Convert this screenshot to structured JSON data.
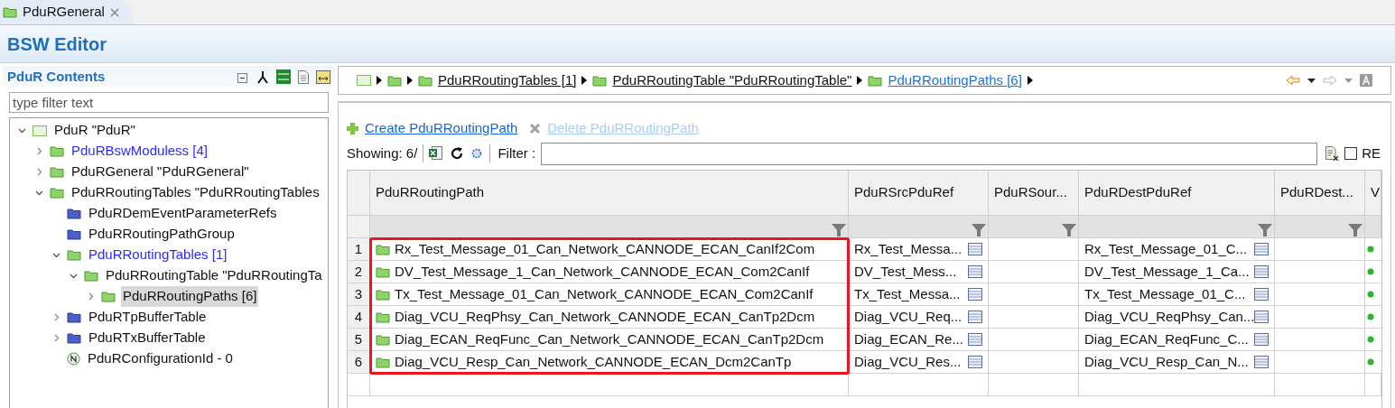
{
  "editor_tab": {
    "label": "PduRGeneral",
    "selected": true
  },
  "editor_title": "BSW Editor",
  "contents_panel": {
    "title": "PduR Contents",
    "filter": {
      "placeholder": "type filter text"
    },
    "tree": [
      {
        "label": "PduR \"PduR\"",
        "kind": "container",
        "expanded": true,
        "children": [
          {
            "label": "PduRBswModuless [4]",
            "kind": "folder",
            "linked": true,
            "expanded": false
          },
          {
            "label": "PduRGeneral \"PduRGeneral\"",
            "kind": "folder",
            "linked": false,
            "expanded": false
          },
          {
            "label": "PduRRoutingTables \"PduRRoutingTables",
            "kind": "folder",
            "linked": false,
            "expanded": true,
            "children": [
              {
                "label": "PduRDemEventParameterRefs",
                "kind": "blue-folder",
                "linked": false
              },
              {
                "label": "PduRRoutingPathGroup",
                "kind": "blue-folder",
                "linked": false
              },
              {
                "label": "PduRRoutingTables [1]",
                "kind": "folder",
                "linked": true,
                "expanded": true,
                "children": [
                  {
                    "label": "PduRRoutingTable \"PduRRoutingTa",
                    "kind": "folder",
                    "linked": false,
                    "expanded": true,
                    "children": [
                      {
                        "label": "PduRRoutingPaths [6]",
                        "kind": "folder",
                        "linked": false,
                        "expanded": false,
                        "selected": true
                      }
                    ]
                  }
                ]
              },
              {
                "label": "PduRTpBufferTable",
                "kind": "blue-folder",
                "linked": false,
                "expanded": false
              },
              {
                "label": "PduRTxBufferTable",
                "kind": "blue-folder",
                "linked": false,
                "expanded": false
              },
              {
                "label": "PduRConfigurationId - 0",
                "kind": "parameter",
                "linked": false
              }
            ]
          }
        ]
      }
    ]
  },
  "breadcrumb": [
    {
      "label": "PduRRoutingTables [1]",
      "current": false
    },
    {
      "label": "PduRRoutingTable \"PduRRoutingTable\"",
      "current": false
    },
    {
      "label": "PduRRoutingPaths [6]",
      "current": true
    }
  ],
  "actions": [
    {
      "label": "Create PduRRoutingPath",
      "disabled": false
    },
    {
      "label": "Delete PduRRoutingPath",
      "disabled": true
    }
  ],
  "showing": "Showing: 6/",
  "filter_label": "Filter :",
  "re_option": {
    "label": "RE",
    "checked": false
  },
  "table": {
    "columns": [
      "PduRRoutingPath",
      "PduRSrcPduRef",
      "PduRSour...",
      "PduRDestPduRef",
      "PduRDest...",
      "V"
    ],
    "rows": [
      {
        "number": "1",
        "path": "Rx_Test_Message_01_Can_Network_CANNODE_ECAN_CanIf2Com",
        "src": "Rx_Test_Messa...",
        "dest": "Rx_Test_Message_01_C..."
      },
      {
        "number": "2",
        "path": "DV_Test_Message_1_Can_Network_CANNODE_ECAN_Com2CanIf",
        "src": "DV_Test_Mess...",
        "dest": "DV_Test_Message_1_Ca..."
      },
      {
        "number": "3",
        "path": "Tx_Test_Message_01_Can_Network_CANNODE_ECAN_Com2CanIf",
        "src": "Tx_Test_Messa...",
        "dest": "Tx_Test_Message_01_C..."
      },
      {
        "number": "4",
        "path": "Diag_VCU_ReqPhsy_Can_Network_CANNODE_ECAN_CanTp2Dcm",
        "src": "Diag_VCU_Req...",
        "dest": "Diag_VCU_ReqPhsy_Can..."
      },
      {
        "number": "5",
        "path": "Diag_ECAN_ReqFunc_Can_Network_CANNODE_ECAN_CanTp2Dcm",
        "src": "Diag_ECAN_Re...",
        "dest": "Diag_ECAN_ReqFunc_C..."
      },
      {
        "number": "6",
        "path": "Diag_VCU_Resp_Can_Network_CANNODE_ECAN_Dcm2CanTp",
        "src": "Diag_VCU_Res...",
        "dest": "Diag_VCU_Resp_Can_N..."
      }
    ]
  }
}
